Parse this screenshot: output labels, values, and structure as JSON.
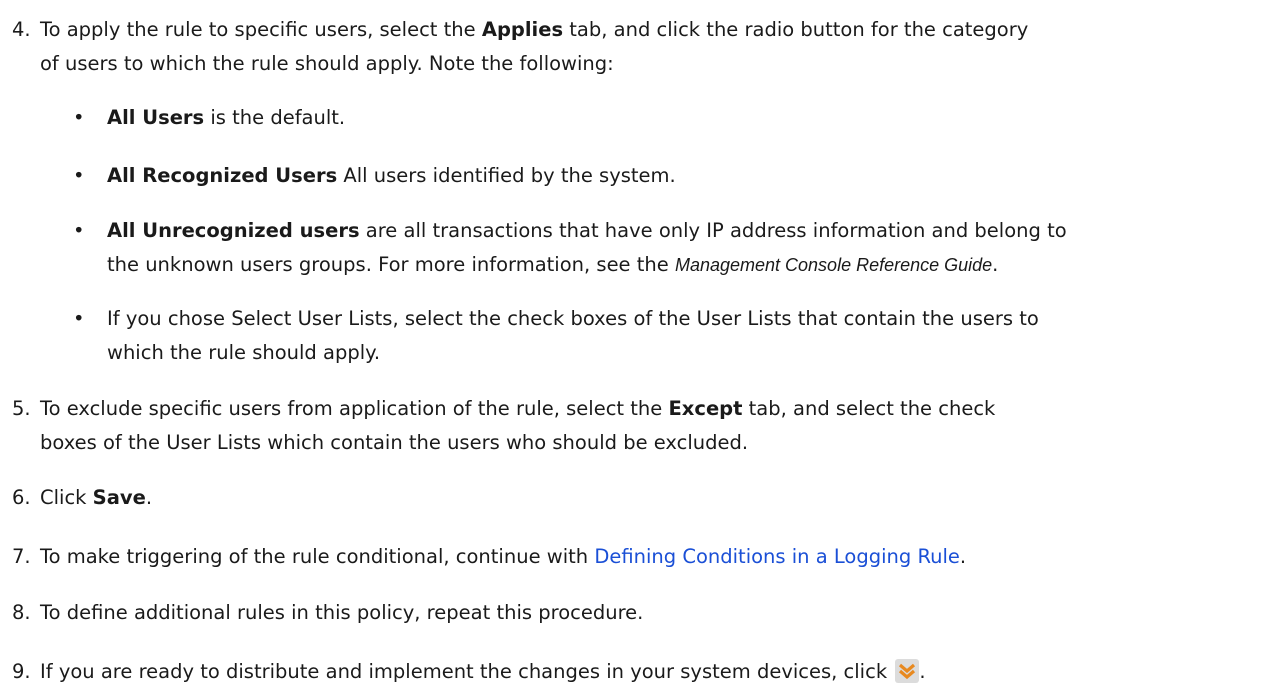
{
  "steps": [
    {
      "num": "4.",
      "line1_pre": "To apply the rule to specific users, select the ",
      "line1_bold": "Applies",
      "line1_post": " tab, and click the radio button for the category",
      "line2": "of users to which the rule should apply. Note the following:"
    },
    {
      "num": "5.",
      "line1_pre": "To exclude specific users from application of the rule, select the ",
      "line1_bold": "Except",
      "line1_post": " tab, and select the check",
      "line2": "boxes of the User Lists which contain the users who should be excluded."
    },
    {
      "num": "6.",
      "pre": "Click ",
      "bold": "Save",
      "post": "."
    },
    {
      "num": "7.",
      "pre": "To make triggering of the rule conditional, continue with ",
      "link": "Defining Conditions in a Logging Rule",
      "post": "."
    },
    {
      "num": "8.",
      "text": "To define additional rules in this policy, repeat this procedure."
    },
    {
      "num": "9.",
      "pre": "If you are ready to distribute and implement the changes in your system devices, click ",
      "post": "."
    }
  ],
  "bullets": [
    {
      "dot": "•",
      "bold": "All Users",
      "rest": " is the default."
    },
    {
      "dot": "•",
      "bold": "All Recognized Users",
      "rest": " All users identified by the system."
    },
    {
      "dot": "•",
      "bold": "All Unrecognized users",
      "rest": " are all transactions that have only IP address information and belong to",
      "line2_pre": "the unknown users groups. For more information, see the ",
      "line2_italic": "Management Console Reference Guide",
      "line2_post": "."
    },
    {
      "dot": "•",
      "line1": "If you chose Select User Lists, select the check boxes of the User Lists that contain the users to",
      "line2": "which the rule should apply."
    }
  ],
  "colors": {
    "text": "#1a1a1a",
    "link": "#1a4fd6",
    "icon_orange": "#e8891f",
    "icon_bg": "#d9d9d9"
  },
  "icons": {
    "distribute": "distribute-changes-icon"
  }
}
